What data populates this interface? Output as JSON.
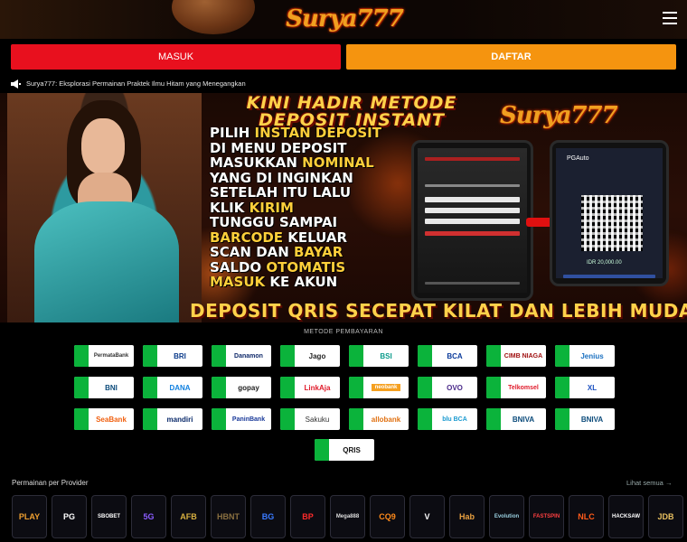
{
  "header": {
    "logo_text": "Surya777",
    "menu_icon": "hamburger-menu-icon"
  },
  "auth": {
    "login_label": "MASUK",
    "register_label": "DAFTAR",
    "login_color": "#e8101e",
    "register_color": "#f5940f"
  },
  "marquee": {
    "icon": "megaphone-icon",
    "text": "Surya777: Eksplorasi Permainan Praktek Ilmu Hitam yang Menegangkan"
  },
  "banner": {
    "title_line1": "KINI HADIR METODE",
    "title_line2": "DEPOSIT INSTANT",
    "logo": "Surya777",
    "steps": [
      {
        "a": "PILIH ",
        "b": "INSTAN DEPOSIT",
        "c": ""
      },
      {
        "a": "DI MENU DEPOSIT",
        "b": "",
        "c": ""
      },
      {
        "a": "MASUKKAN ",
        "b": "NOMINAL",
        "c": ""
      },
      {
        "a": "YANG DI INGINKAN",
        "b": "",
        "c": ""
      },
      {
        "a": "SETELAH ITU LALU",
        "b": "",
        "c": ""
      },
      {
        "a": "KLIK ",
        "b": "KIRIM",
        "c": ""
      },
      {
        "a": "TUNGGU SAMPAI",
        "b": "",
        "c": ""
      },
      {
        "a": "",
        "b": "BARCODE",
        "c": " KELUAR"
      },
      {
        "a": "SCAN DAN ",
        "b": "BAYAR",
        "c": ""
      },
      {
        "a": "SALDO ",
        "b": "OTOMATIS",
        "c": ""
      },
      {
        "a": "",
        "b": "MASUK",
        "c": " KE AKUN"
      }
    ],
    "footer": "DEPOSIT QRIS SECEPAT KILAT DAN LEBIH MUDAH",
    "phone_b_header": "PGAuto",
    "phone_b_amount": "IDR 20,000.00"
  },
  "payment": {
    "title": "METODE PEMBAYARAN",
    "methods": [
      "PermataBank",
      "BRI",
      "Danamon",
      "Jago",
      "BSI",
      "BCA",
      "CIMB NIAGA",
      "Jenius",
      "BNI",
      "DANA",
      "gopay",
      "LinkAja",
      "neobank",
      "OVO",
      "Telkomsel",
      "XL",
      "SeaBank",
      "mandiri",
      "PaninBank",
      "Sakuku",
      "allobank",
      "blu BCA",
      "BNIVA",
      "BNIVA",
      "QRIS"
    ]
  },
  "providers": {
    "title": "Permainan per Provider",
    "more_label": "Lihat semua",
    "items": [
      {
        "name": "PLAY",
        "color": "#f0a030"
      },
      {
        "name": "PG",
        "color": "#ffffff"
      },
      {
        "name": "SBOBET",
        "color": "#ffffff"
      },
      {
        "name": "5G",
        "color": "#8a5cff"
      },
      {
        "name": "AFB",
        "color": "#d8b040"
      },
      {
        "name": "HBNT",
        "color": "#8a7040"
      },
      {
        "name": "BG",
        "color": "#3a7aff"
      },
      {
        "name": "BP",
        "color": "#ff2a2a"
      },
      {
        "name": "Mega888",
        "color": "#dddddd"
      },
      {
        "name": "CQ9",
        "color": "#ff8a1a"
      },
      {
        "name": "V",
        "color": "#ffffff"
      },
      {
        "name": "Hab",
        "color": "#e8a040"
      },
      {
        "name": "Evolution",
        "color": "#9ad0e0"
      },
      {
        "name": "FASTSPIN",
        "color": "#ff4040"
      },
      {
        "name": "NLC",
        "color": "#ff5a1a"
      },
      {
        "name": "HACKSAW",
        "color": "#ffffff"
      },
      {
        "name": "JDB",
        "color": "#e8c060"
      }
    ]
  }
}
